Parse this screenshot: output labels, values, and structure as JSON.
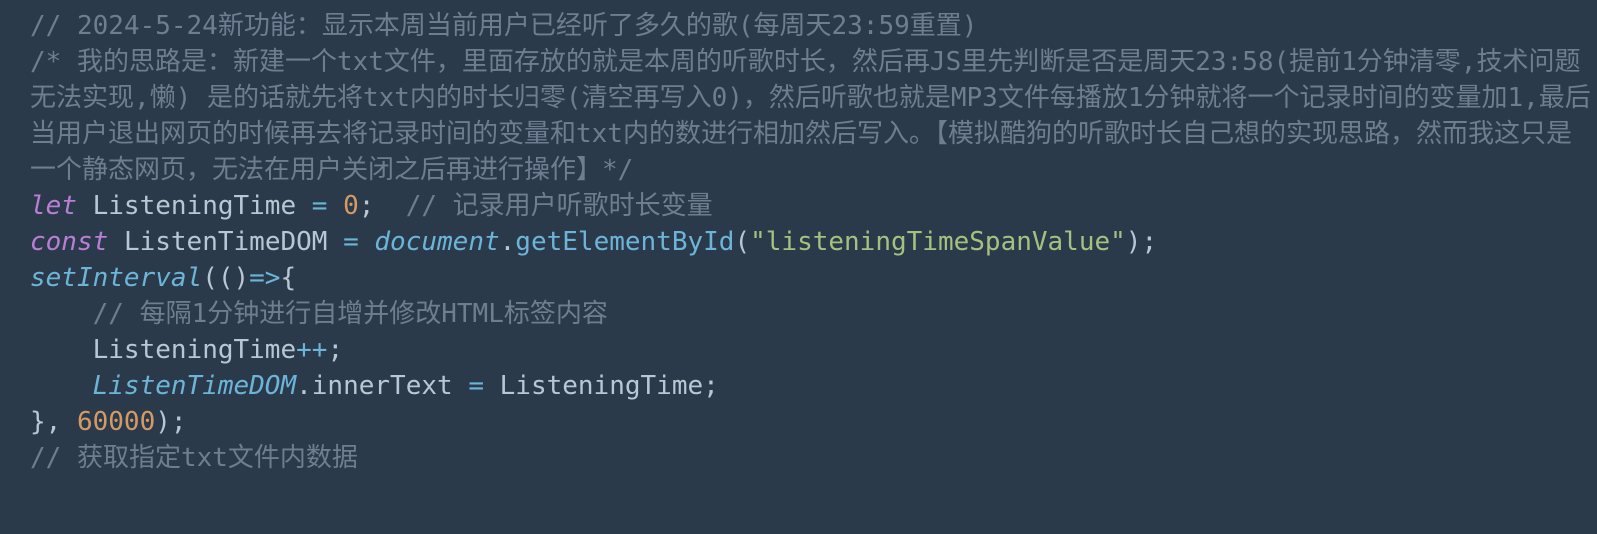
{
  "code": {
    "lines": [
      {
        "tokens": [
          {
            "cls": "c",
            "text": "// 2024-5-24新功能：显示本周当前用户已经听了多久的歌(每周天23:59重置)"
          }
        ]
      },
      {
        "tokens": [
          {
            "cls": "c",
            "text": "/* 我的思路是：新建一个txt文件，里面存放的就是本周的听歌时长，然后再JS里先判断是否是周天23:58(提前1分钟清零,技术问题无法实现,懒) 是的话就先将txt内的时长归零(清空再写入0)，然后听歌也就是MP3文件每播放1分钟就将一个记录时间的变量加1,最后当用户退出网页的时候再去将记录时间的变量和txt内的数进行相加然后写入。【模拟酷狗的听歌时长自己想的实现思路，然而我这只是一个静态网页，无法在用户关闭之后再进行操作】*/"
          }
        ]
      },
      {
        "tokens": [
          {
            "cls": "kw",
            "text": "let"
          },
          {
            "cls": "pn",
            "text": " "
          },
          {
            "cls": "id",
            "text": "ListeningTime"
          },
          {
            "cls": "pn",
            "text": " "
          },
          {
            "cls": "op",
            "text": "="
          },
          {
            "cls": "pn",
            "text": " "
          },
          {
            "cls": "nm",
            "text": "0"
          },
          {
            "cls": "pn",
            "text": ";  "
          },
          {
            "cls": "c",
            "text": "// 记录用户听歌时长变量"
          }
        ]
      },
      {
        "tokens": [
          {
            "cls": "kw",
            "text": "const"
          },
          {
            "cls": "pn",
            "text": " "
          },
          {
            "cls": "id",
            "text": "ListenTimeDOM"
          },
          {
            "cls": "pn",
            "text": " "
          },
          {
            "cls": "op",
            "text": "="
          },
          {
            "cls": "pn",
            "text": " "
          },
          {
            "cls": "fi",
            "text": "document"
          },
          {
            "cls": "pn",
            "text": "."
          },
          {
            "cls": "fn",
            "text": "getElementById"
          },
          {
            "cls": "pn",
            "text": "("
          },
          {
            "cls": "st",
            "text": "\"listeningTimeSpanValue\""
          },
          {
            "cls": "pn",
            "text": ");"
          }
        ]
      },
      {
        "tokens": [
          {
            "cls": "fi",
            "text": "setInterval"
          },
          {
            "cls": "pn",
            "text": "(()"
          },
          {
            "cls": "op",
            "text": "=>"
          },
          {
            "cls": "pn",
            "text": "{"
          }
        ]
      },
      {
        "tokens": [
          {
            "cls": "pn",
            "text": "    "
          },
          {
            "cls": "c",
            "text": "// 每隔1分钟进行自增并修改HTML标签内容"
          }
        ]
      },
      {
        "tokens": [
          {
            "cls": "pn",
            "text": "    "
          },
          {
            "cls": "id",
            "text": "ListeningTime"
          },
          {
            "cls": "op",
            "text": "++"
          },
          {
            "cls": "pn",
            "text": ";"
          }
        ]
      },
      {
        "tokens": [
          {
            "cls": "pn",
            "text": "    "
          },
          {
            "cls": "fi",
            "text": "ListenTimeDOM"
          },
          {
            "cls": "pn",
            "text": "."
          },
          {
            "cls": "id",
            "text": "innerText"
          },
          {
            "cls": "pn",
            "text": " "
          },
          {
            "cls": "op",
            "text": "="
          },
          {
            "cls": "pn",
            "text": " "
          },
          {
            "cls": "id",
            "text": "ListeningTime"
          },
          {
            "cls": "pn",
            "text": ";"
          }
        ]
      },
      {
        "tokens": [
          {
            "cls": "pn",
            "text": "}, "
          },
          {
            "cls": "nm",
            "text": "60000"
          },
          {
            "cls": "pn",
            "text": ");"
          }
        ]
      },
      {
        "tokens": [
          {
            "cls": "c",
            "text": "// 获取指定txt文件内数据"
          }
        ]
      }
    ]
  }
}
